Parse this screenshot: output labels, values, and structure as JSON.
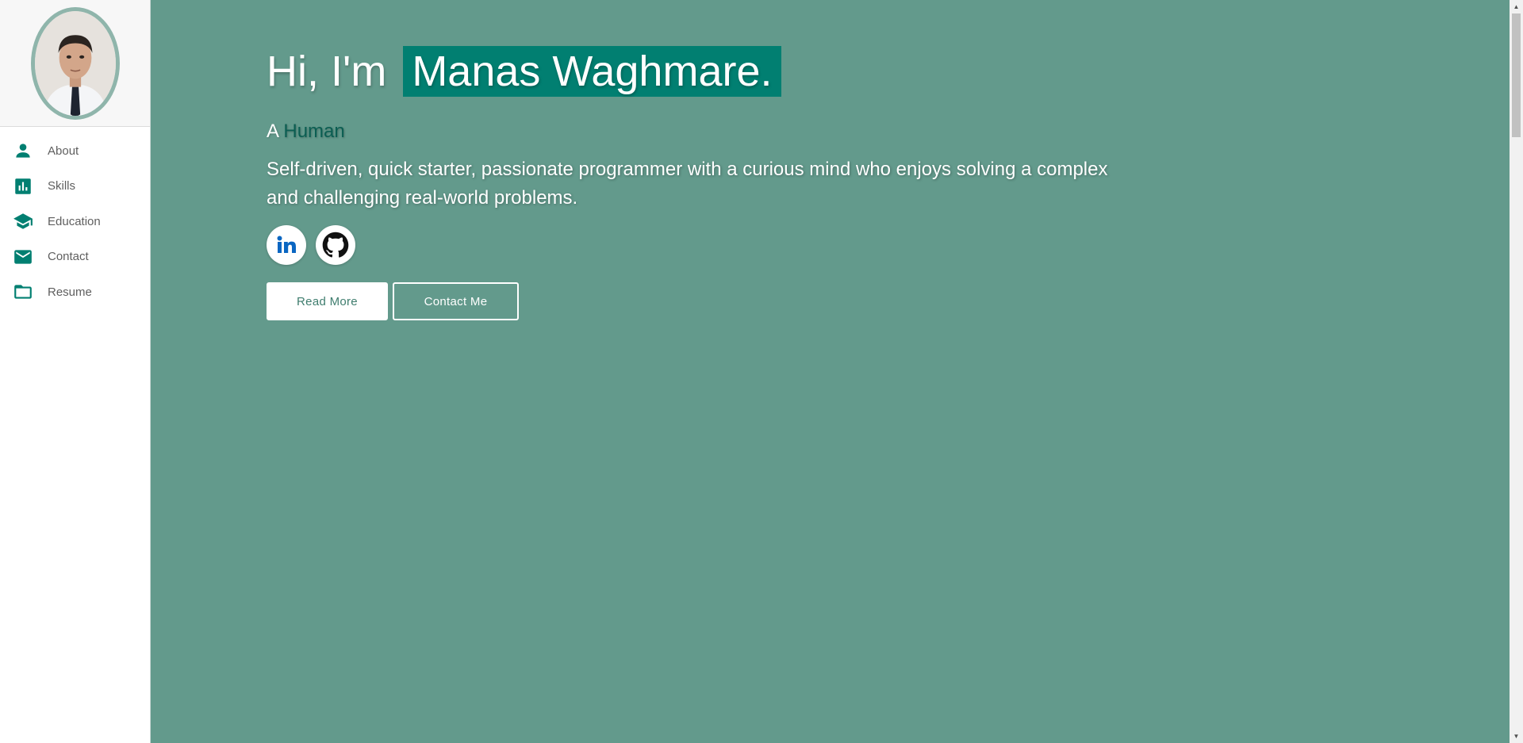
{
  "sidebar": {
    "items": [
      {
        "label": "About",
        "icon": "person-icon"
      },
      {
        "label": "Skills",
        "icon": "bar-chart-icon"
      },
      {
        "label": "Education",
        "icon": "graduation-cap-icon"
      },
      {
        "label": "Contact",
        "icon": "mail-icon"
      },
      {
        "label": "Resume",
        "icon": "folder-icon"
      }
    ]
  },
  "hero": {
    "greeting_prefix": "Hi, I'm",
    "name": "Manas Waghmare.",
    "role_prefix": "A",
    "role_word": "Human",
    "bio": "Self-driven, quick starter, passionate programmer with a curious mind who enjoys solving a complex and challenging real-world problems.",
    "read_more_label": "Read More",
    "contact_label": "Contact Me"
  },
  "socials": [
    {
      "name": "LinkedIn",
      "icon": "linkedin-icon"
    },
    {
      "name": "GitHub",
      "icon": "github-icon"
    }
  ],
  "colors": {
    "accent": "#017f71",
    "background": "#639a8c",
    "icon": "#017f71"
  }
}
